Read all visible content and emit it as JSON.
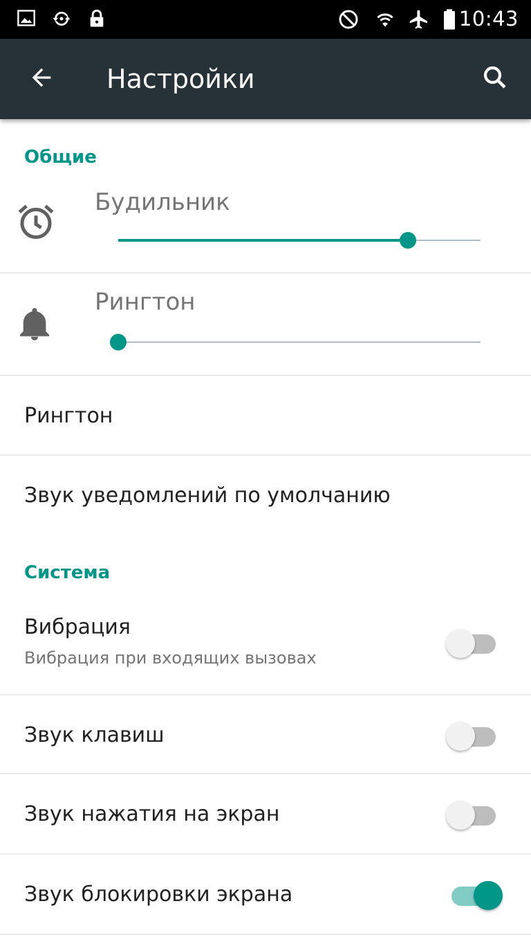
{
  "status_bar": {
    "time": "10:43",
    "left_icons": [
      "gallery-icon",
      "sync-icon",
      "lock-icon"
    ],
    "right_icons": [
      "do-not-disturb-icon",
      "wifi-icon",
      "airplane-icon",
      "battery-icon"
    ]
  },
  "toolbar": {
    "title": "Настройки",
    "back_icon": "arrow-back-icon",
    "search_icon": "search-icon"
  },
  "sections": {
    "general": {
      "header": "Общие",
      "alarm": {
        "label": "Будильник",
        "icon": "alarm-clock-icon",
        "level": 0.8
      },
      "ringtone_volume": {
        "label": "Рингтон",
        "icon": "bell-icon",
        "level": 0.0
      },
      "ringtone": {
        "title": "Рингтон"
      },
      "notification_sound": {
        "title": "Звук уведомлений по умолчанию"
      }
    },
    "system": {
      "header": "Система",
      "vibration": {
        "title": "Вибрация",
        "subtitle": "Вибрация при входящих вызовах",
        "enabled": false
      },
      "key_sound": {
        "title": "Звук клавиш",
        "enabled": false
      },
      "touch_sound": {
        "title": "Звук нажатия на экран",
        "enabled": false
      },
      "lock_sound": {
        "title": "Звук блокировки экрана",
        "enabled": true
      }
    }
  },
  "colors": {
    "accent": "#009688",
    "toolbar": "#263238",
    "status_bar": "#000000"
  }
}
